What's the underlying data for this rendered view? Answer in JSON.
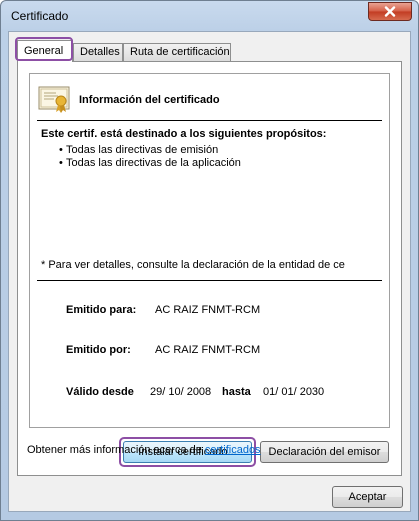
{
  "window": {
    "title": "Certificado"
  },
  "tabs": [
    {
      "label": "General",
      "active": true
    },
    {
      "label": "Detalles",
      "active": false
    },
    {
      "label": "Ruta de certificación",
      "active": false
    }
  ],
  "info": {
    "title": "Información del certificado",
    "purposes_heading": "Este certif. está destinado a los siguientes propósitos:",
    "purposes": [
      "Todas las directivas de emisión",
      "Todas las directivas de la aplicación"
    ],
    "bullet": "•",
    "note": "* Para ver detalles, consulte la declaración de la entidad de ce",
    "issued_to_label": "Emitido para:",
    "issued_to_value": "AC RAIZ FNMT-RCM",
    "issued_by_label": "Emitido por:",
    "issued_by_value": "AC RAIZ FNMT-RCM",
    "valid_from_label": "Válido desde",
    "valid_from_value": "29/ 10/ 2008",
    "valid_to_label": "hasta",
    "valid_to_value": "01/ 01/ 2030"
  },
  "buttons": {
    "install": "Instalar certificado...",
    "issuer_statement": "Declaración del emisor",
    "accept": "Aceptar"
  },
  "more_info": {
    "prefix": "Obtener más información acerca de ",
    "link": "certificados"
  },
  "colors": {
    "highlight": "#8d4fa5",
    "link": "#0066cc",
    "close_button": "#c23b22"
  },
  "icons": {
    "close": "close-icon",
    "certificate": "certificate-icon"
  }
}
